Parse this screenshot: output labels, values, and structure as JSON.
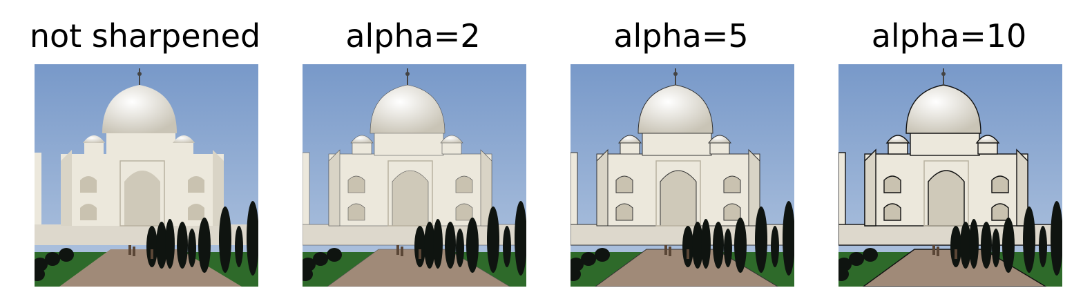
{
  "panels": [
    {
      "title": "not sharpened",
      "sharpness": "none"
    },
    {
      "title": "alpha=2",
      "sharpness": "low"
    },
    {
      "title": "alpha=5",
      "sharpness": "medium"
    },
    {
      "title": "alpha=10",
      "sharpness": "high"
    }
  ],
  "image_subject": "taj-mahal-photo",
  "colors": {
    "sky_base": "#7899c9",
    "marble": "#ece8dc",
    "grass": "#2e6a2a",
    "trees": "#0f1410",
    "path": "#a08a78"
  }
}
